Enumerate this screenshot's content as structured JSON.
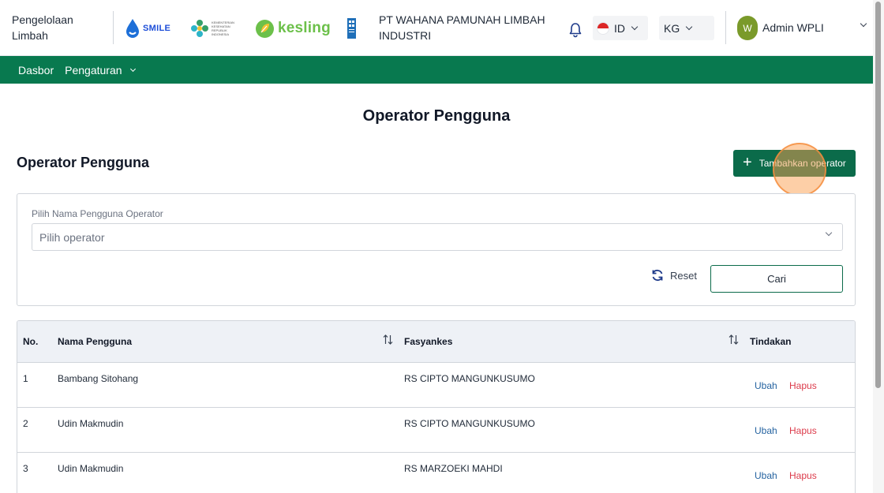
{
  "header": {
    "app_title": "Pengelolaan Limbah",
    "logos": [
      {
        "name": "smile-logo",
        "text": "SMILE",
        "icon": "drop-icon",
        "color": "#1d4ed8"
      },
      {
        "name": "kemenkes-logo",
        "text": "KEMENTERIAN KESEHATAN REPUBLIK INDONESIA",
        "icon": "kemenkes-emblem-icon"
      },
      {
        "name": "kesling-logo",
        "text": "kesling",
        "icon": "leaf-icon",
        "color": "#6cc04a"
      },
      {
        "name": "undp-logo",
        "icon": "undp-icon"
      }
    ],
    "company_name": "PT WAHANA PAMUNAH LIMBAH INDUSTRI",
    "language": "ID",
    "unit": "KG",
    "user_initial": "W",
    "user_name": "Admin WPLI"
  },
  "nav": {
    "items": [
      {
        "label": "Dasbor"
      },
      {
        "label": "Pengaturan"
      }
    ]
  },
  "main": {
    "page_title": "Operator Pengguna",
    "section_title": "Operator Pengguna",
    "add_button": "Tambahkan operator",
    "filter": {
      "label": "Pilih Nama Pengguna Operator",
      "placeholder": "Pilih operator",
      "reset": "Reset",
      "search": "Cari"
    },
    "table": {
      "headers": {
        "no": "No.",
        "name": "Nama Pengguna",
        "fasyankes": "Fasyankes",
        "action": "Tindakan"
      },
      "rows": [
        {
          "no": "1",
          "name": "Bambang Sitohang",
          "fasyankes": "RS CIPTO MANGUNKUSUMO",
          "edit": "Ubah",
          "delete": "Hapus"
        },
        {
          "no": "2",
          "name": "Udin Makmudin",
          "fasyankes": "RS CIPTO MANGUNKUSUMO",
          "edit": "Ubah",
          "delete": "Hapus"
        },
        {
          "no": "3",
          "name": "Udin Makmudin",
          "fasyankes": "RS MARZOEKI MAHDI",
          "edit": "Ubah",
          "delete": "Hapus"
        }
      ]
    }
  },
  "colors": {
    "brand_green": "#08794f",
    "button_green": "#0b6b4a",
    "edit_blue": "#2563a0",
    "delete_red": "#dc3a4a"
  }
}
